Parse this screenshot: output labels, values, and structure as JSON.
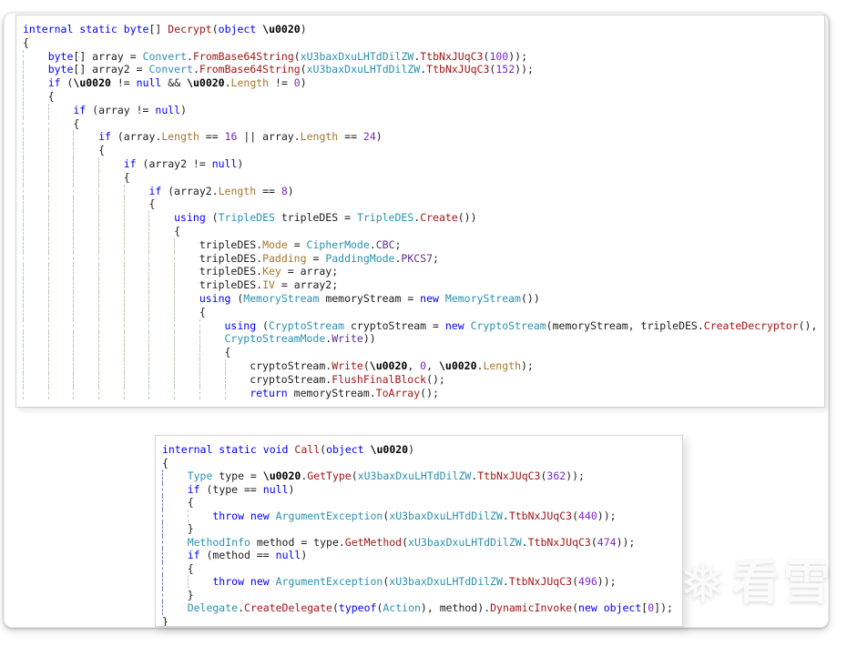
{
  "app": "decompiler-code-view",
  "palette": {
    "kw": "#0000ff",
    "ty": "#2b91af",
    "me": "#a31515",
    "pr": "#a5772e",
    "nu": "#7a28c8",
    "en": "#5c2d91",
    "pl": "#1c1c1c",
    "pb": "#000000",
    "guide": "#b7cdb7",
    "guide_active": "#6a82cc",
    "popup_background": "#ffffff",
    "popup_border": "#ccd2da"
  },
  "watermark": {
    "icon": "snowflake-icon",
    "icon_glyph": "❅",
    "text": "看雪"
  },
  "code_blocks": [
    {
      "name": "decrypt-method",
      "active_guide": false,
      "lines": [
        {
          "indent": 0,
          "tokens": [
            [
              "kw",
              "internal static byte"
            ],
            [
              "pl",
              "[] "
            ],
            [
              "me",
              "Decrypt"
            ],
            [
              "pl",
              "("
            ],
            [
              "kw",
              "object"
            ],
            [
              "pl",
              " "
            ],
            [
              "pb",
              "\\u0020"
            ],
            [
              "pl",
              ")"
            ]
          ]
        },
        {
          "indent": 0,
          "tokens": [
            [
              "pl",
              "{"
            ]
          ]
        },
        {
          "indent": 4,
          "tokens": [
            [
              "kw",
              "byte"
            ],
            [
              "pl",
              "[] array = "
            ],
            [
              "ty",
              "Convert"
            ],
            [
              "pl",
              "."
            ],
            [
              "me",
              "FromBase64String"
            ],
            [
              "pl",
              "("
            ],
            [
              "ty",
              "xU3baxDxuLHTdDilZW"
            ],
            [
              "pl",
              "."
            ],
            [
              "me",
              "TtbNxJUqC3"
            ],
            [
              "pl",
              "("
            ],
            [
              "nu",
              "100"
            ],
            [
              "pl",
              "));"
            ]
          ]
        },
        {
          "indent": 4,
          "tokens": [
            [
              "kw",
              "byte"
            ],
            [
              "pl",
              "[] array2 = "
            ],
            [
              "ty",
              "Convert"
            ],
            [
              "pl",
              "."
            ],
            [
              "me",
              "FromBase64String"
            ],
            [
              "pl",
              "("
            ],
            [
              "ty",
              "xU3baxDxuLHTdDilZW"
            ],
            [
              "pl",
              "."
            ],
            [
              "me",
              "TtbNxJUqC3"
            ],
            [
              "pl",
              "("
            ],
            [
              "nu",
              "152"
            ],
            [
              "pl",
              "));"
            ]
          ]
        },
        {
          "indent": 4,
          "tokens": [
            [
              "kw",
              "if"
            ],
            [
              "pl",
              " ("
            ],
            [
              "pb",
              "\\u0020"
            ],
            [
              "pl",
              " != "
            ],
            [
              "kw",
              "null"
            ],
            [
              "pl",
              " && "
            ],
            [
              "pb",
              "\\u0020"
            ],
            [
              "pl",
              "."
            ],
            [
              "pr",
              "Length"
            ],
            [
              "pl",
              " != "
            ],
            [
              "nu",
              "0"
            ],
            [
              "pl",
              ")"
            ]
          ]
        },
        {
          "indent": 4,
          "tokens": [
            [
              "pl",
              "{"
            ]
          ]
        },
        {
          "indent": 8,
          "tokens": [
            [
              "kw",
              "if"
            ],
            [
              "pl",
              " (array != "
            ],
            [
              "kw",
              "null"
            ],
            [
              "pl",
              ")"
            ]
          ]
        },
        {
          "indent": 8,
          "tokens": [
            [
              "pl",
              "{"
            ]
          ]
        },
        {
          "indent": 12,
          "tokens": [
            [
              "kw",
              "if"
            ],
            [
              "pl",
              " (array."
            ],
            [
              "pr",
              "Length"
            ],
            [
              "pl",
              " == "
            ],
            [
              "nu",
              "16"
            ],
            [
              "pl",
              " || array."
            ],
            [
              "pr",
              "Length"
            ],
            [
              "pl",
              " == "
            ],
            [
              "nu",
              "24"
            ],
            [
              "pl",
              ")"
            ]
          ]
        },
        {
          "indent": 12,
          "tokens": [
            [
              "pl",
              "{"
            ]
          ]
        },
        {
          "indent": 16,
          "tokens": [
            [
              "kw",
              "if"
            ],
            [
              "pl",
              " (array2 != "
            ],
            [
              "kw",
              "null"
            ],
            [
              "pl",
              ")"
            ]
          ]
        },
        {
          "indent": 16,
          "tokens": [
            [
              "pl",
              "{"
            ]
          ]
        },
        {
          "indent": 20,
          "tokens": [
            [
              "kw",
              "if"
            ],
            [
              "pl",
              " (array2."
            ],
            [
              "pr",
              "Length"
            ],
            [
              "pl",
              " == "
            ],
            [
              "nu",
              "8"
            ],
            [
              "pl",
              ")"
            ]
          ]
        },
        {
          "indent": 20,
          "tokens": [
            [
              "pl",
              "{"
            ]
          ]
        },
        {
          "indent": 24,
          "tokens": [
            [
              "kw",
              "using"
            ],
            [
              "pl",
              " ("
            ],
            [
              "ty",
              "TripleDES"
            ],
            [
              "pl",
              " tripleDES = "
            ],
            [
              "ty",
              "TripleDES"
            ],
            [
              "pl",
              "."
            ],
            [
              "me",
              "Create"
            ],
            [
              "pl",
              "())"
            ]
          ]
        },
        {
          "indent": 24,
          "tokens": [
            [
              "pl",
              "{"
            ]
          ]
        },
        {
          "indent": 28,
          "tokens": [
            [
              "pl",
              "tripleDES."
            ],
            [
              "pr",
              "Mode"
            ],
            [
              "pl",
              " = "
            ],
            [
              "ty",
              "CipherMode"
            ],
            [
              "pl",
              "."
            ],
            [
              "en",
              "CBC"
            ],
            [
              "pl",
              ";"
            ]
          ]
        },
        {
          "indent": 28,
          "tokens": [
            [
              "pl",
              "tripleDES."
            ],
            [
              "pr",
              "Padding"
            ],
            [
              "pl",
              " = "
            ],
            [
              "ty",
              "PaddingMode"
            ],
            [
              "pl",
              "."
            ],
            [
              "en",
              "PKCS7"
            ],
            [
              "pl",
              ";"
            ]
          ]
        },
        {
          "indent": 28,
          "tokens": [
            [
              "pl",
              "tripleDES."
            ],
            [
              "pr",
              "Key"
            ],
            [
              "pl",
              " = array;"
            ]
          ]
        },
        {
          "indent": 28,
          "tokens": [
            [
              "pl",
              "tripleDES."
            ],
            [
              "pr",
              "IV"
            ],
            [
              "pl",
              " = array2;"
            ]
          ]
        },
        {
          "indent": 28,
          "tokens": [
            [
              "kw",
              "using"
            ],
            [
              "pl",
              " ("
            ],
            [
              "ty",
              "MemoryStream"
            ],
            [
              "pl",
              " memoryStream = "
            ],
            [
              "kw",
              "new"
            ],
            [
              "pl",
              " "
            ],
            [
              "ty",
              "MemoryStream"
            ],
            [
              "pl",
              "())"
            ]
          ]
        },
        {
          "indent": 28,
          "tokens": [
            [
              "pl",
              "{"
            ]
          ]
        },
        {
          "indent": 32,
          "tokens": [
            [
              "kw",
              "using"
            ],
            [
              "pl",
              " ("
            ],
            [
              "ty",
              "CryptoStream"
            ],
            [
              "pl",
              " cryptoStream = "
            ],
            [
              "kw",
              "new"
            ],
            [
              "pl",
              " "
            ],
            [
              "ty",
              "CryptoStream"
            ],
            [
              "pl",
              "(memoryStream, tripleDES."
            ],
            [
              "me",
              "CreateDecryptor"
            ],
            [
              "pl",
              "(),"
            ]
          ]
        },
        {
          "indent": 32,
          "tokens": [
            [
              "ty",
              "CryptoStreamMode"
            ],
            [
              "pl",
              "."
            ],
            [
              "en",
              "Write"
            ],
            [
              "pl",
              "))"
            ]
          ]
        },
        {
          "indent": 32,
          "tokens": [
            [
              "pl",
              "{"
            ]
          ]
        },
        {
          "indent": 36,
          "tokens": [
            [
              "pl",
              "cryptoStream."
            ],
            [
              "me",
              "Write"
            ],
            [
              "pl",
              "("
            ],
            [
              "pb",
              "\\u0020"
            ],
            [
              "pl",
              ", "
            ],
            [
              "nu",
              "0"
            ],
            [
              "pl",
              ", "
            ],
            [
              "pb",
              "\\u0020"
            ],
            [
              "pl",
              "."
            ],
            [
              "pr",
              "Length"
            ],
            [
              "pl",
              ");"
            ]
          ]
        },
        {
          "indent": 36,
          "tokens": [
            [
              "pl",
              "cryptoStream."
            ],
            [
              "me",
              "FlushFinalBlock"
            ],
            [
              "pl",
              "();"
            ]
          ]
        },
        {
          "indent": 36,
          "tokens": [
            [
              "kw",
              "return"
            ],
            [
              "pl",
              " memoryStream."
            ],
            [
              "me",
              "ToArray"
            ],
            [
              "pl",
              "();"
            ]
          ]
        }
      ]
    },
    {
      "name": "call-method",
      "active_guide": true,
      "lines": [
        {
          "indent": 0,
          "tokens": [
            [
              "kw",
              "internal static void"
            ],
            [
              "pl",
              " "
            ],
            [
              "me",
              "Call"
            ],
            [
              "pl",
              "("
            ],
            [
              "kw",
              "object"
            ],
            [
              "pl",
              " "
            ],
            [
              "pb",
              "\\u0020"
            ],
            [
              "pl",
              ")"
            ]
          ]
        },
        {
          "indent": 0,
          "tokens": [
            [
              "pl",
              "{"
            ]
          ]
        },
        {
          "indent": 4,
          "tokens": [
            [
              "ty",
              "Type"
            ],
            [
              "pl",
              " type = "
            ],
            [
              "pb",
              "\\u0020"
            ],
            [
              "pl",
              "."
            ],
            [
              "me",
              "GetType"
            ],
            [
              "pl",
              "("
            ],
            [
              "ty",
              "xU3baxDxuLHTdDilZW"
            ],
            [
              "pl",
              "."
            ],
            [
              "me",
              "TtbNxJUqC3"
            ],
            [
              "pl",
              "("
            ],
            [
              "nu",
              "362"
            ],
            [
              "pl",
              "));"
            ]
          ]
        },
        {
          "indent": 4,
          "tokens": [
            [
              "kw",
              "if"
            ],
            [
              "pl",
              " (type == "
            ],
            [
              "kw",
              "null"
            ],
            [
              "pl",
              ")"
            ]
          ]
        },
        {
          "indent": 4,
          "tokens": [
            [
              "pl",
              "{"
            ]
          ]
        },
        {
          "indent": 8,
          "tokens": [
            [
              "kw",
              "throw new"
            ],
            [
              "pl",
              " "
            ],
            [
              "ty",
              "ArgumentException"
            ],
            [
              "pl",
              "("
            ],
            [
              "ty",
              "xU3baxDxuLHTdDilZW"
            ],
            [
              "pl",
              "."
            ],
            [
              "me",
              "TtbNxJUqC3"
            ],
            [
              "pl",
              "("
            ],
            [
              "nu",
              "440"
            ],
            [
              "pl",
              "));"
            ]
          ]
        },
        {
          "indent": 4,
          "tokens": [
            [
              "pl",
              "}"
            ]
          ]
        },
        {
          "indent": 4,
          "tokens": [
            [
              "ty",
              "MethodInfo"
            ],
            [
              "pl",
              " method = type."
            ],
            [
              "me",
              "GetMethod"
            ],
            [
              "pl",
              "("
            ],
            [
              "ty",
              "xU3baxDxuLHTdDilZW"
            ],
            [
              "pl",
              "."
            ],
            [
              "me",
              "TtbNxJUqC3"
            ],
            [
              "pl",
              "("
            ],
            [
              "nu",
              "474"
            ],
            [
              "pl",
              "));"
            ]
          ]
        },
        {
          "indent": 4,
          "tokens": [
            [
              "kw",
              "if"
            ],
            [
              "pl",
              " (method == "
            ],
            [
              "kw",
              "null"
            ],
            [
              "pl",
              ")"
            ]
          ]
        },
        {
          "indent": 4,
          "tokens": [
            [
              "pl",
              "{"
            ]
          ]
        },
        {
          "indent": 8,
          "tokens": [
            [
              "kw",
              "throw new"
            ],
            [
              "pl",
              " "
            ],
            [
              "ty",
              "ArgumentException"
            ],
            [
              "pl",
              "("
            ],
            [
              "ty",
              "xU3baxDxuLHTdDilZW"
            ],
            [
              "pl",
              "."
            ],
            [
              "me",
              "TtbNxJUqC3"
            ],
            [
              "pl",
              "("
            ],
            [
              "nu",
              "496"
            ],
            [
              "pl",
              "));"
            ]
          ]
        },
        {
          "indent": 4,
          "tokens": [
            [
              "pl",
              "}"
            ]
          ]
        },
        {
          "indent": 4,
          "tokens": [
            [
              "ty",
              "Delegate"
            ],
            [
              "pl",
              "."
            ],
            [
              "me",
              "CreateDelegate"
            ],
            [
              "pl",
              "("
            ],
            [
              "kw",
              "typeof"
            ],
            [
              "pl",
              "("
            ],
            [
              "ty",
              "Action"
            ],
            [
              "pl",
              "), method)."
            ],
            [
              "me",
              "DynamicInvoke"
            ],
            [
              "pl",
              "("
            ],
            [
              "kw",
              "new object"
            ],
            [
              "pl",
              "["
            ],
            [
              "nu",
              "0"
            ],
            [
              "pl",
              "]);"
            ]
          ]
        },
        {
          "indent": 0,
          "tokens": [
            [
              "pl",
              "}"
            ]
          ]
        }
      ]
    }
  ]
}
